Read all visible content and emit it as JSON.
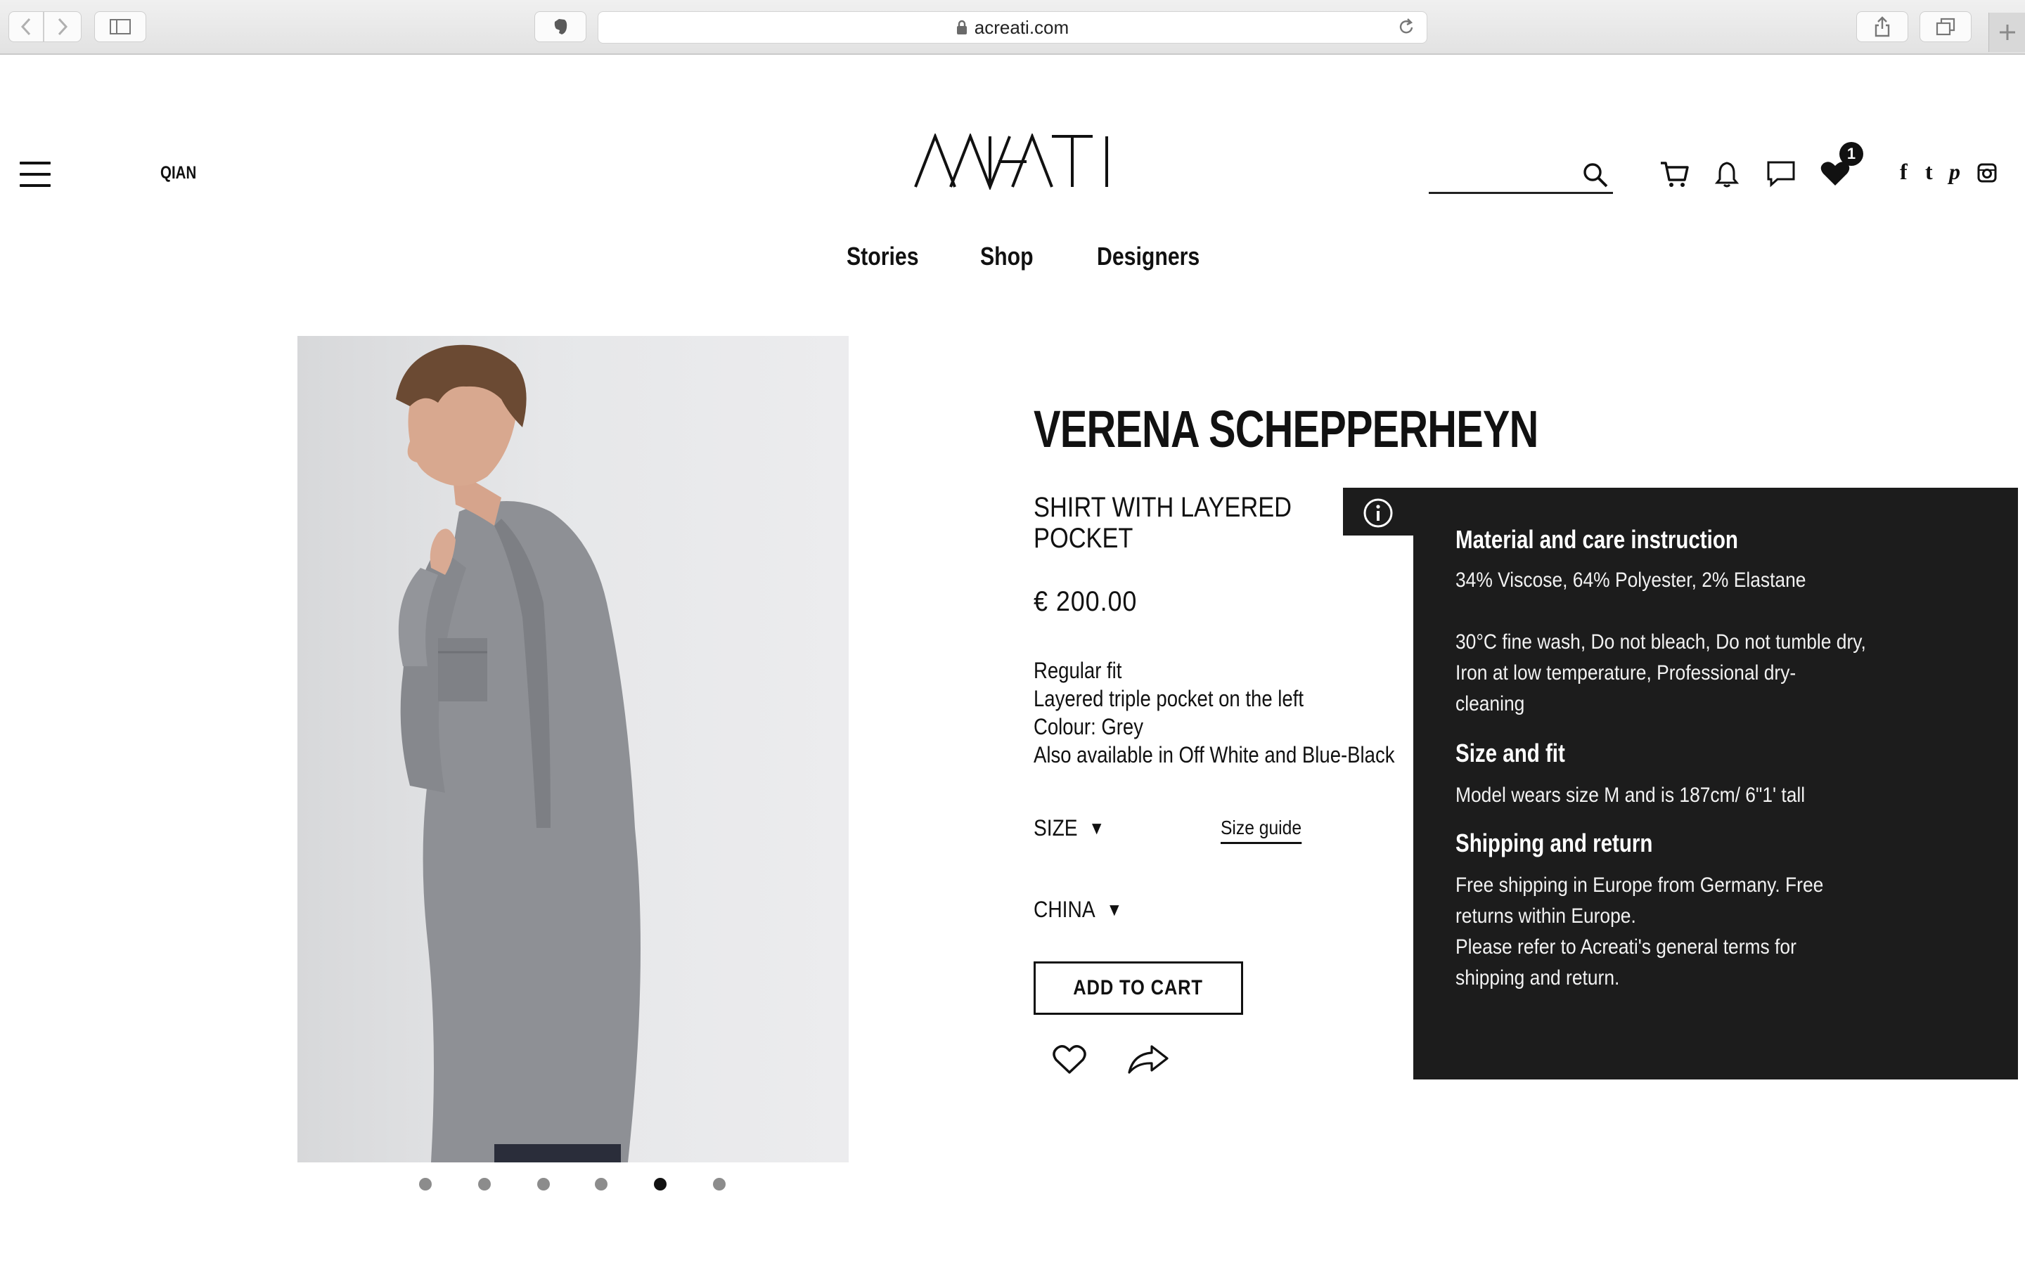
{
  "browser": {
    "url": "acreati.com"
  },
  "header": {
    "user_name": "QIAN",
    "logo_text": "ACREATI",
    "search_placeholder": "",
    "wishlist_count": "1",
    "social": [
      "f",
      "t",
      "p"
    ]
  },
  "nav": {
    "items": [
      {
        "label": "Stories"
      },
      {
        "label": "Shop"
      },
      {
        "label": "Designers"
      }
    ]
  },
  "gallery": {
    "dot_count": 6,
    "active_index": 4
  },
  "product": {
    "designer": "VERENA SCHEPPERHEYN",
    "title": "SHIRT WITH LAYERED POCKET",
    "price": "€ 200.00",
    "description": [
      "Regular fit",
      "Layered triple pocket on the left",
      "Colour: Grey",
      "Also available in Off White and Blue-Black"
    ],
    "size_label": "SIZE",
    "size_caret": "▼",
    "size_guide": "Size guide",
    "country_label": "CHINA",
    "country_caret": "▼",
    "add_to_cart": "ADD TO CART"
  },
  "info_panel": {
    "sections": [
      {
        "heading": "Material and care instruction",
        "lines": [
          "34% Viscose, 64% Polyester, 2% Elastane",
          "",
          "30°C fine wash, Do not bleach, Do not tumble dry,",
          "Iron at low temperature, Professional dry-",
          "cleaning"
        ]
      },
      {
        "heading": "Size and fit",
        "lines": [
          "Model wears size M and is 187cm/ 6\"1' tall"
        ]
      },
      {
        "heading": "Shipping and return",
        "lines": [
          "Free shipping in Europe from Germany. Free",
          "returns within Europe.",
          "Please refer to Acreati's general terms for",
          "shipping and return."
        ]
      }
    ]
  },
  "colors": {
    "panel_bg": "#1c1c1c",
    "text": "#111111",
    "dot_inactive": "#8c8c8c"
  }
}
